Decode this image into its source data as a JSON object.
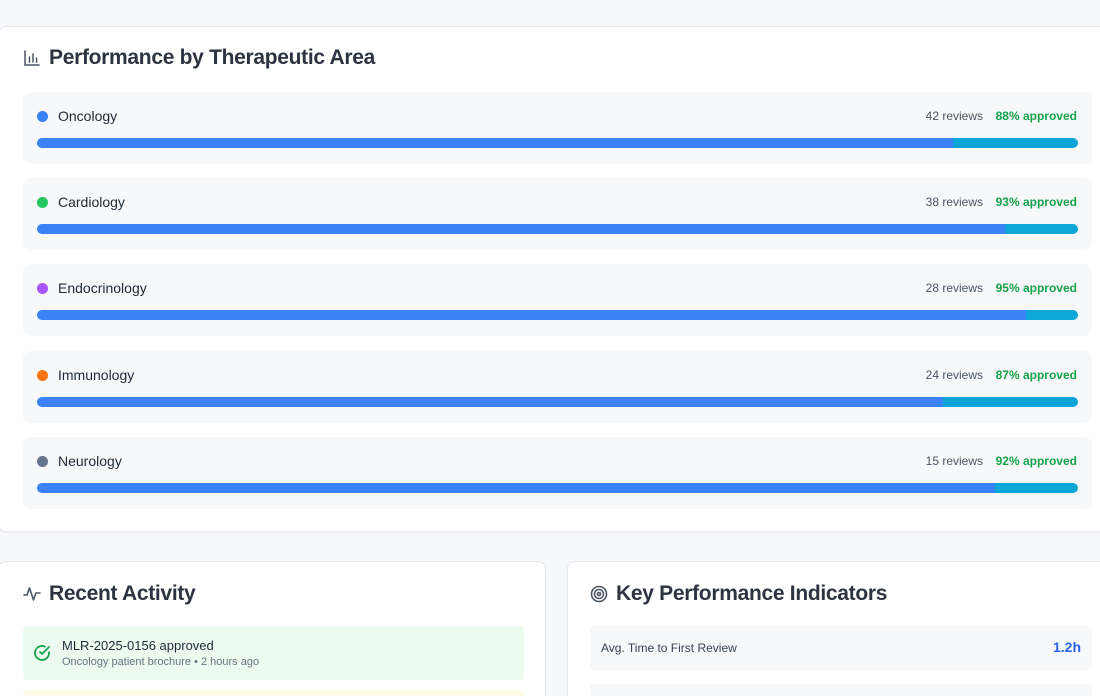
{
  "performance": {
    "title": "Performance by Therapeutic Area",
    "areas": [
      {
        "name": "Oncology",
        "reviews": "42 reviews",
        "approved": "88% approved",
        "approved_fraction": 0.88,
        "color": "#3b82f6"
      },
      {
        "name": "Cardiology",
        "reviews": "38 reviews",
        "approved": "93% approved",
        "approved_fraction": 0.93,
        "color": "#22c55e"
      },
      {
        "name": "Endocrinology",
        "reviews": "28 reviews",
        "approved": "95% approved",
        "approved_fraction": 0.95,
        "color": "#a855f7"
      },
      {
        "name": "Immunology",
        "reviews": "24 reviews",
        "approved": "87% approved",
        "approved_fraction": 0.87,
        "color": "#f97316"
      },
      {
        "name": "Neurology",
        "reviews": "15 reviews",
        "approved": "92% approved",
        "approved_fraction": 0.92,
        "color": "#64748b"
      }
    ],
    "bar_fill_color": "#3b82f6",
    "bar_remainder_color": "#0ea5d9",
    "approved_text_color": "#16a34a"
  },
  "activity": {
    "title": "Recent Activity",
    "items": [
      {
        "title": "MLR-2025-0156 approved",
        "subtitle": "Oncology patient brochure • 2 hours ago"
      }
    ]
  },
  "kpi": {
    "title": "Key Performance Indicators",
    "items": [
      {
        "label": "Avg. Time to First Review",
        "value": "1.2h"
      }
    ]
  }
}
